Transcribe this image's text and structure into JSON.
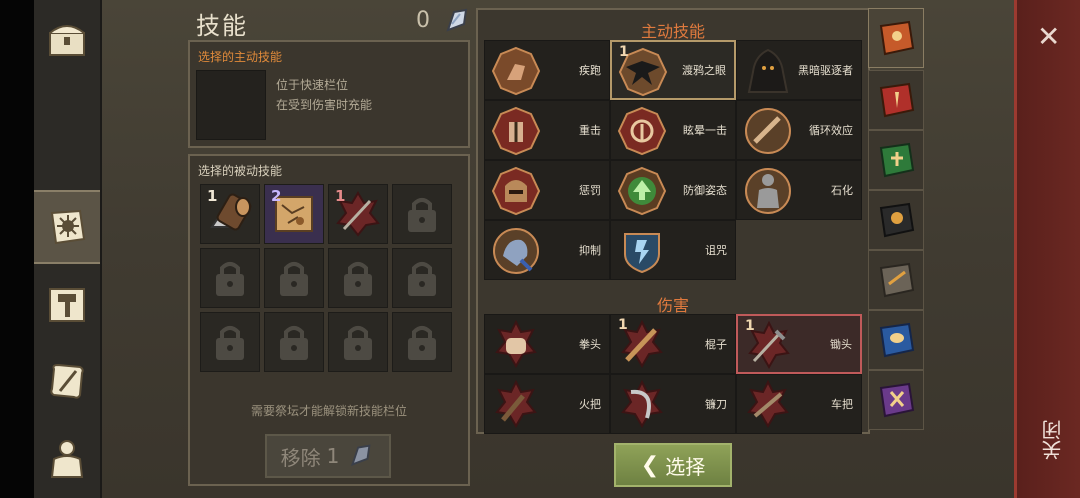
{
  "page": {
    "title": "技能",
    "currency": "0"
  },
  "nav": {
    "items": [
      "chest-icon",
      "skills-book-icon",
      "crafting-hammer-icon",
      "scroll-quill-icon",
      "character-equipment-icon"
    ]
  },
  "active_skill_panel": {
    "heading": "选择的主动技能",
    "desc_line1": "位于快速栏位",
    "desc_line2": "在受到伤害时充能"
  },
  "passive_panel": {
    "heading": "选择的被动技能",
    "slots": [
      {
        "name": "logs-skill",
        "count": "1"
      },
      {
        "name": "map-skill",
        "count": "2"
      },
      {
        "name": "spear-skill",
        "count": "1"
      }
    ],
    "hint": "需要祭坛才能解锁新技能栏位"
  },
  "remove_button": {
    "label": "移除",
    "count": "1"
  },
  "skills_panel": {
    "active_title": "主动技能",
    "active_skills": [
      {
        "label": "疾跑",
        "num": ""
      },
      {
        "label": "渡鸦之眼",
        "num": "1"
      },
      {
        "label": "黑暗驱逐者",
        "num": ""
      },
      {
        "label": "重击",
        "num": ""
      },
      {
        "label": "眩晕一击",
        "num": ""
      },
      {
        "label": "循环效应",
        "num": ""
      },
      {
        "label": "惩罚",
        "num": ""
      },
      {
        "label": "防御姿态",
        "num": ""
      },
      {
        "label": "石化",
        "num": ""
      },
      {
        "label": "抑制",
        "num": ""
      },
      {
        "label": "诅咒",
        "num": ""
      }
    ],
    "damage_title": "伤害",
    "damage_skills": [
      {
        "label": "拳头",
        "num": ""
      },
      {
        "label": "棍子",
        "num": "1"
      },
      {
        "label": "锄头",
        "num": "1"
      },
      {
        "label": "火把",
        "num": ""
      },
      {
        "label": "镰刀",
        "num": ""
      },
      {
        "label": "车把",
        "num": ""
      }
    ]
  },
  "select_button": {
    "label": "选择"
  },
  "close": {
    "label": "关闭"
  },
  "colors": {
    "accent_orange": "#e07a3e",
    "select_green": "#7f9250",
    "close_red": "#6b2822"
  }
}
